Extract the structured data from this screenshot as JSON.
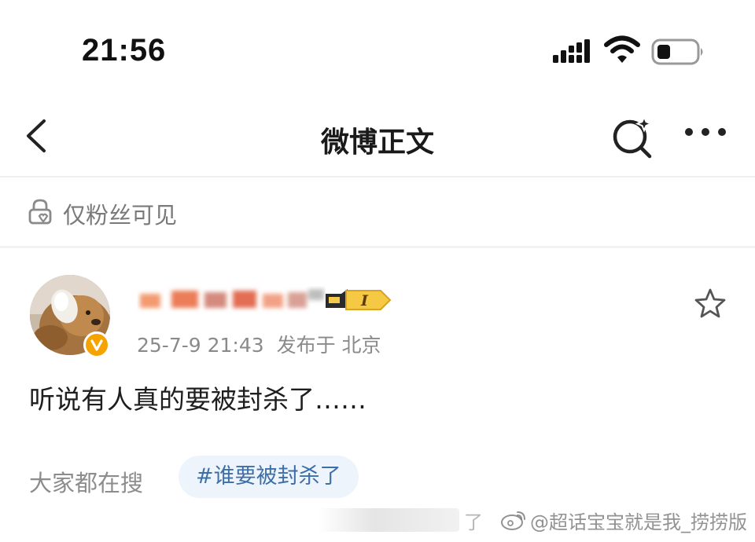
{
  "status_bar": {
    "time": "21:56",
    "icons": [
      "signal-icon",
      "wifi-icon",
      "battery-icon"
    ]
  },
  "nav": {
    "title": "微博正文",
    "icons": [
      "back-icon",
      "search-ai-icon",
      "more-icon"
    ]
  },
  "visibility": {
    "text": "仅粉丝可见",
    "icon": "lock-icon"
  },
  "post": {
    "user_level_label": "I",
    "timestamp": "25-7-9 21:43",
    "publish_location": "发布于 北京",
    "text": "听说有人真的要被封杀了……",
    "icons": [
      "avatar",
      "verified-badge-icon",
      "star-icon"
    ]
  },
  "search_section": {
    "label": "大家都在搜",
    "topic": "#谁要被封杀了"
  },
  "watermark": {
    "partial_text": "了",
    "text": "@超话宝宝就是我_捞捞版",
    "icon": "weibo-logo-icon"
  },
  "colors": {
    "accent_gold": "#f6a300",
    "topic_text": "#3e6ea8",
    "topic_bg": "#eef4fb",
    "meta_gray": "#8a8a8a"
  }
}
